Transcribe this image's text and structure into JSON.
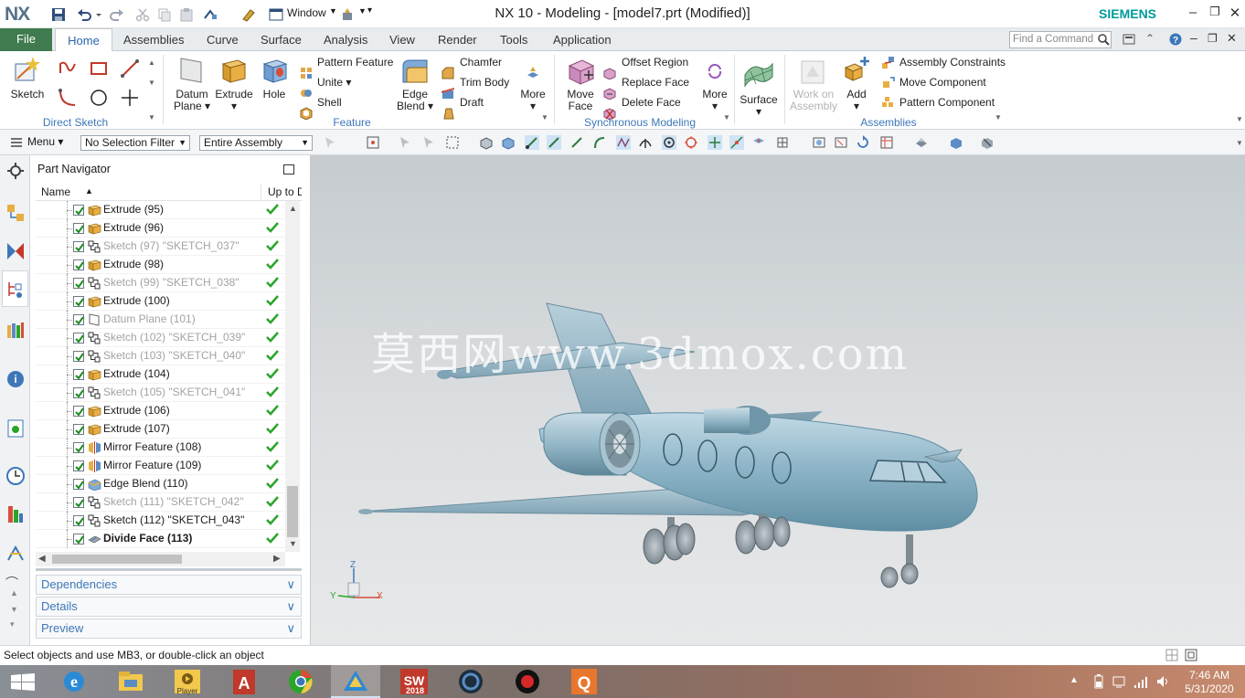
{
  "titlebar": {
    "logo": "NX",
    "window_menu": "Window",
    "title": "NX 10 - Modeling - [model7.prt (Modified)]",
    "brand": "SIEMENS"
  },
  "tabs": {
    "file": "File",
    "items": [
      "Home",
      "Assemblies",
      "Curve",
      "Surface",
      "Analysis",
      "View",
      "Render",
      "Tools",
      "Application"
    ],
    "find_placeholder": "Find a Command"
  },
  "ribbon": {
    "direct_sketch": {
      "sketch": "Sketch",
      "group": "Direct Sketch"
    },
    "feature": {
      "datum_plane_1": "Datum",
      "datum_plane_2": "Plane",
      "extrude": "Extrude",
      "hole": "Hole",
      "pattern_feature": "Pattern Feature",
      "unite": "Unite",
      "shell": "Shell",
      "edge_blend_1": "Edge",
      "edge_blend_2": "Blend",
      "chamfer": "Chamfer",
      "trim_body": "Trim Body",
      "draft": "Draft",
      "more": "More",
      "group": "Feature"
    },
    "sync": {
      "move_face_1": "Move",
      "move_face_2": "Face",
      "offset_region": "Offset Region",
      "replace_face": "Replace Face",
      "delete_face": "Delete Face",
      "more": "More",
      "group": "Synchronous Modeling"
    },
    "surface": {
      "label": "Surface"
    },
    "assemblies": {
      "work_on_1": "Work on",
      "work_on_2": "Assembly",
      "add": "Add",
      "constraints": "Assembly Constraints",
      "move_component": "Move Component",
      "pattern_component": "Pattern Component",
      "group": "Assemblies"
    }
  },
  "selbar": {
    "menu": "Menu",
    "filter": "No Selection Filter",
    "scope": "Entire Assembly"
  },
  "navigator": {
    "title": "Part Navigator",
    "col_name": "Name",
    "col_uptodate": "Up to D",
    "rows": [
      {
        "label": "Extrude (95)",
        "type": "extrude",
        "style": "normal"
      },
      {
        "label": "Extrude (96)",
        "type": "extrude",
        "style": "normal"
      },
      {
        "label": "Sketch (97) \"SKETCH_037\"",
        "type": "sketch",
        "style": "gray"
      },
      {
        "label": "Extrude (98)",
        "type": "extrude",
        "style": "normal"
      },
      {
        "label": "Sketch (99) \"SKETCH_038\"",
        "type": "sketch",
        "style": "gray"
      },
      {
        "label": "Extrude (100)",
        "type": "extrude",
        "style": "normal"
      },
      {
        "label": "Datum Plane (101)",
        "type": "datum",
        "style": "gray"
      },
      {
        "label": "Sketch (102) \"SKETCH_039\"",
        "type": "sketch",
        "style": "gray"
      },
      {
        "label": "Sketch (103) \"SKETCH_040\"",
        "type": "sketch",
        "style": "gray"
      },
      {
        "label": "Extrude (104)",
        "type": "extrude",
        "style": "normal"
      },
      {
        "label": "Sketch (105) \"SKETCH_041\"",
        "type": "sketch",
        "style": "gray"
      },
      {
        "label": "Extrude (106)",
        "type": "extrude",
        "style": "normal"
      },
      {
        "label": "Extrude (107)",
        "type": "extrude",
        "style": "normal"
      },
      {
        "label": "Mirror Feature (108)",
        "type": "mirror",
        "style": "normal"
      },
      {
        "label": "Mirror Feature (109)",
        "type": "mirror",
        "style": "normal"
      },
      {
        "label": "Edge Blend (110)",
        "type": "blend",
        "style": "normal"
      },
      {
        "label": "Sketch (111) \"SKETCH_042\"",
        "type": "sketch",
        "style": "gray"
      },
      {
        "label": "Sketch (112) \"SKETCH_043\"",
        "type": "sketch",
        "style": "normal"
      },
      {
        "label": "Divide Face (113)",
        "type": "divide",
        "style": "bold"
      }
    ],
    "panels": [
      "Dependencies",
      "Details",
      "Preview"
    ]
  },
  "viewport": {
    "watermark": "莫西网www.3dmox.com",
    "triad": {
      "z": "Z",
      "y": "Y",
      "x": "X"
    }
  },
  "status": {
    "text": "Select objects and use MB3, or double-click an object"
  },
  "taskbar": {
    "time": "7:46 AM",
    "date": "5/31/2020",
    "player": "Player",
    "sw_year": "2018"
  },
  "colors": {
    "file_tab": "#3f7b4f",
    "accent": "#3d77b8",
    "brand": "#009999",
    "check": "#2aa52a"
  }
}
